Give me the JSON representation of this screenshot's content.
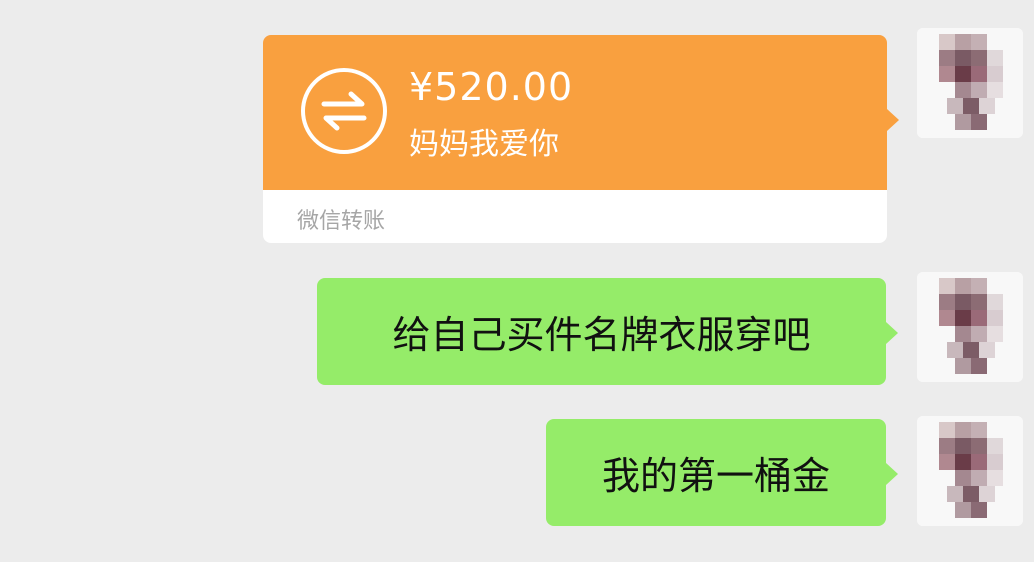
{
  "transfer": {
    "amount": "¥520.00",
    "note": "妈妈我爱你",
    "label": "微信转账",
    "icon": "transfer-arrows-icon",
    "color": "#f9a03f"
  },
  "messages": [
    {
      "text": "给自己买件名牌衣服穿吧"
    },
    {
      "text": "我的第一桶金"
    }
  ],
  "colors": {
    "background": "#ececec",
    "bubble_green": "#95ec69",
    "transfer_orange": "#f9a03f"
  }
}
